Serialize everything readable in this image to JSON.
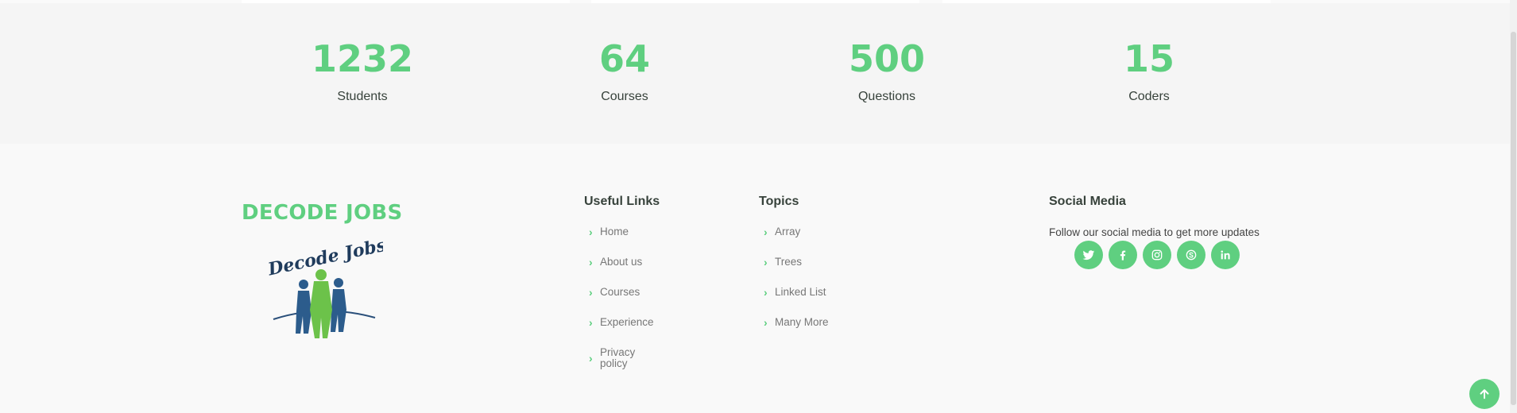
{
  "stats": [
    {
      "value": "1232",
      "label": "Students"
    },
    {
      "value": "64",
      "label": "Courses"
    },
    {
      "value": "500",
      "label": "Questions"
    },
    {
      "value": "15",
      "label": "Coders"
    }
  ],
  "footer": {
    "brand": "DECODE JOBS",
    "logo_text": "Decode Jobs",
    "useful_links": {
      "title": "Useful Links",
      "items": [
        "Home",
        "About us",
        "Courses",
        "Experience",
        "Privacy policy"
      ]
    },
    "topics": {
      "title": "Topics",
      "items": [
        "Array",
        "Trees",
        "Linked List",
        "Many More"
      ]
    },
    "social": {
      "title": "Social Media",
      "text": "Follow our social media to get more updates",
      "icons": [
        "twitter-icon",
        "facebook-icon",
        "instagram-icon",
        "skype-icon",
        "linkedin-icon"
      ]
    }
  },
  "colors": {
    "accent": "#5fcf80",
    "text_dark": "#37423b",
    "link": "#777777",
    "stats_bg": "#f5f5f5",
    "footer_bg": "#f9f9f9"
  }
}
